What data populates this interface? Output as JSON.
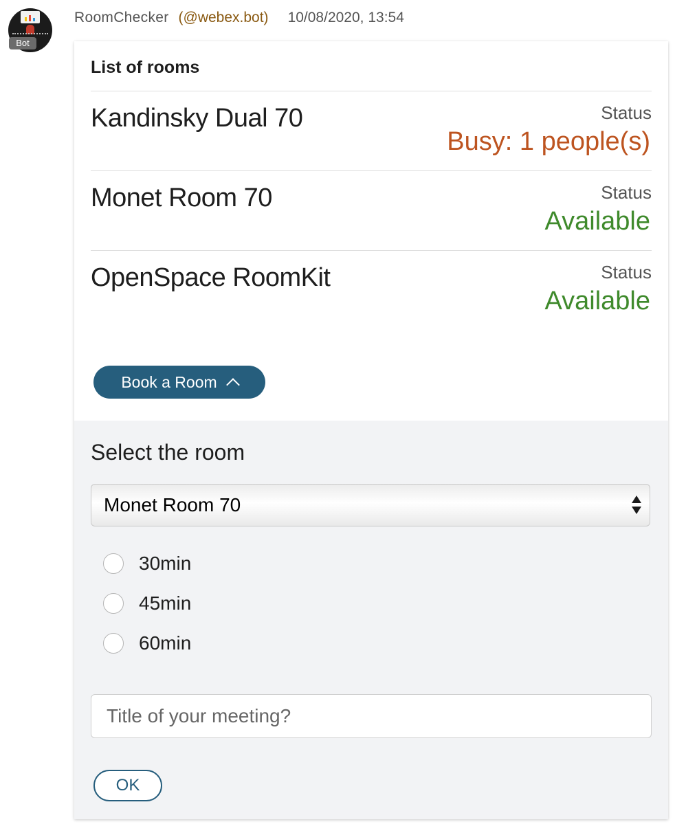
{
  "message": {
    "sender": "RoomChecker",
    "handle": "(@webex.bot)",
    "timestamp": "10/08/2020, 13:54",
    "avatar_badge": "Bot"
  },
  "card": {
    "title": "List of rooms",
    "rooms": [
      {
        "name": "Kandinsky Dual 70",
        "status_label": "Status",
        "status": "Busy: 1 people(s)",
        "status_color": "#bd5420"
      },
      {
        "name": "Monet Room 70",
        "status_label": "Status",
        "status": "Available",
        "status_color": "#3f8a2c"
      },
      {
        "name": "OpenSpace RoomKit",
        "status_label": "Status",
        "status": "Available",
        "status_color": "#3f8a2c"
      }
    ],
    "book_button": {
      "label": "Book a Room",
      "icon": "chevron-up-icon"
    },
    "form": {
      "select_label": "Select the room",
      "room_select": {
        "value": "Monet Room 70"
      },
      "durations": [
        "30min",
        "45min",
        "60min"
      ],
      "title_input": {
        "placeholder": "Title of your meeting?",
        "value": ""
      },
      "ok_label": "OK"
    }
  },
  "colors": {
    "accent": "#265e7d",
    "busy": "#bd5420",
    "available": "#3f8a2c",
    "handle": "#8a5a12"
  }
}
